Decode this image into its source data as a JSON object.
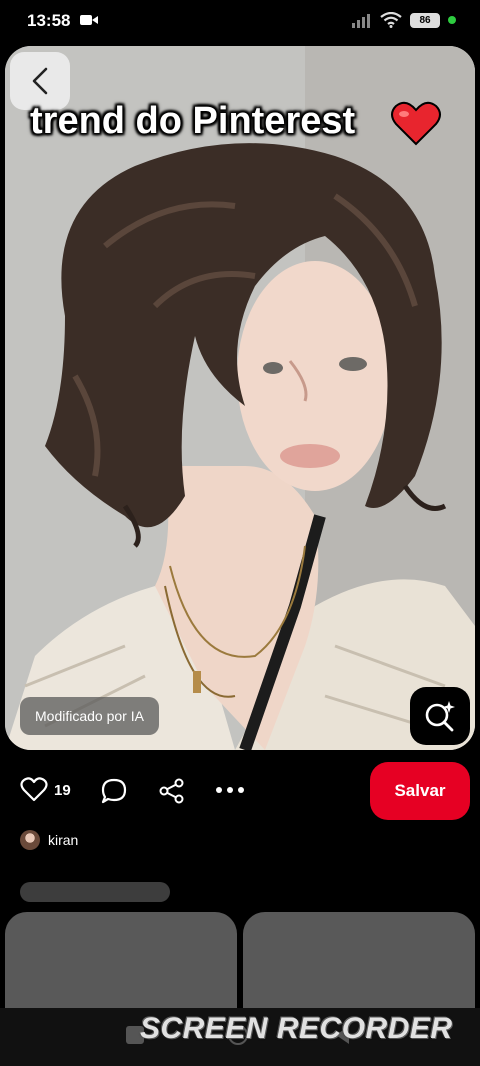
{
  "status_bar": {
    "time": "13:58",
    "battery": "86"
  },
  "pin": {
    "overlay_text": "trend do Pinterest",
    "ai_badge": "Modificado por IA"
  },
  "actions": {
    "like_count": "19",
    "save_label": "Salvar"
  },
  "author": {
    "name": "kiran"
  },
  "watermark": "SCREEN RECORDER",
  "colors": {
    "save_button": "#e60023",
    "background": "#000000",
    "skeleton": "#595959"
  }
}
